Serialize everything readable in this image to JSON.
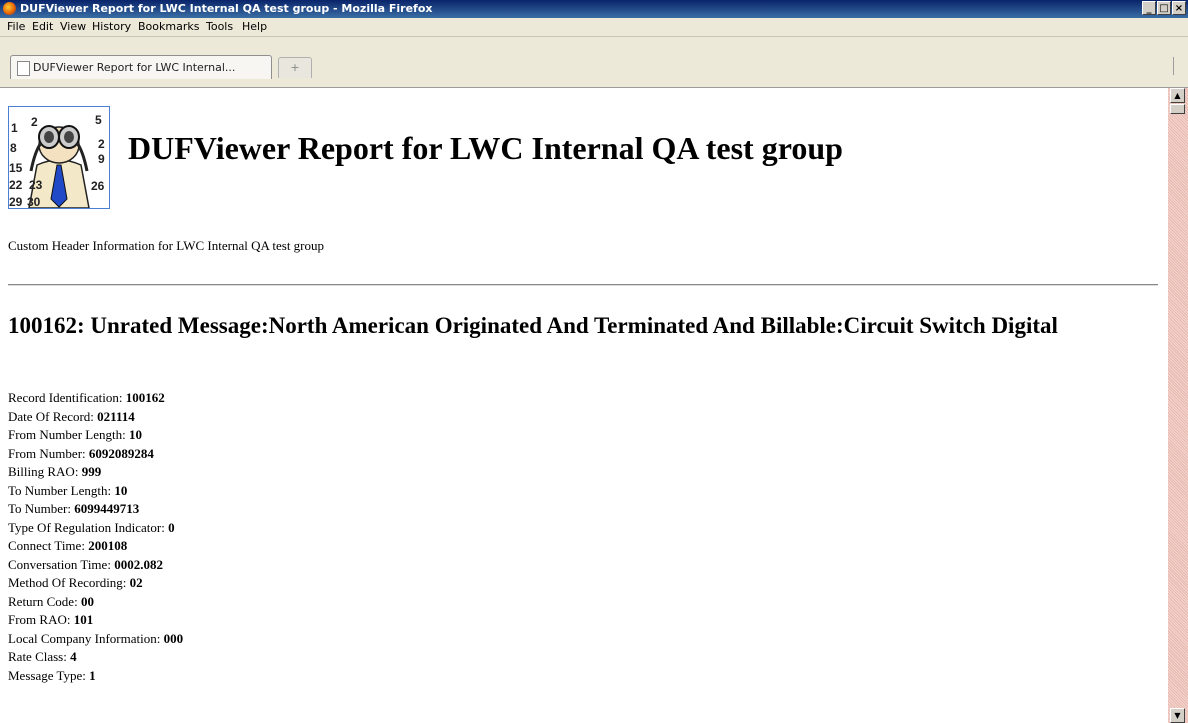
{
  "window": {
    "title": "DUFViewer Report for LWC Internal QA test group - Mozilla Firefox",
    "buttons": [
      "_",
      "□",
      "×"
    ]
  },
  "menu": [
    "File",
    "Edit",
    "View",
    "History",
    "Bookmarks",
    "Tools",
    "Help"
  ],
  "tab": {
    "label": "DUFViewer Report for LWC Internal..."
  },
  "logo": {
    "numbers": [
      "1",
      "2",
      "5",
      "8",
      "2",
      "9",
      "15",
      "22",
      "23",
      "26",
      "29",
      "30"
    ]
  },
  "page": {
    "title": "DUFViewer Report for LWC Internal QA test group",
    "custom_header": "Custom Header Information for LWC Internal QA test group",
    "record_title": "100162: Unrated Message:North American Originated And Terminated And Billable:Circuit Switch Digital"
  },
  "fields": [
    {
      "label": "Record Identification: ",
      "value": "100162"
    },
    {
      "label": "Date Of Record: ",
      "value": "021114"
    },
    {
      "label": "From Number Length: ",
      "value": "10"
    },
    {
      "label": "From Number: ",
      "value": "6092089284"
    },
    {
      "label": "Billing RAO: ",
      "value": "999"
    },
    {
      "label": "To Number Length: ",
      "value": "10"
    },
    {
      "label": "To Number: ",
      "value": "6099449713"
    },
    {
      "label": "Type Of Regulation Indicator: ",
      "value": "0"
    },
    {
      "label": "Connect Time: ",
      "value": "200108"
    },
    {
      "label": "Conversation Time: ",
      "value": "0002.082"
    },
    {
      "label": "Method Of Recording: ",
      "value": "02"
    },
    {
      "label": "Return Code: ",
      "value": "00"
    },
    {
      "label": "From RAO: ",
      "value": "101"
    },
    {
      "label": "Local Company Information: ",
      "value": "000"
    },
    {
      "label": "Rate Class: ",
      "value": "4"
    },
    {
      "label": "Message Type: ",
      "value": "1"
    }
  ]
}
